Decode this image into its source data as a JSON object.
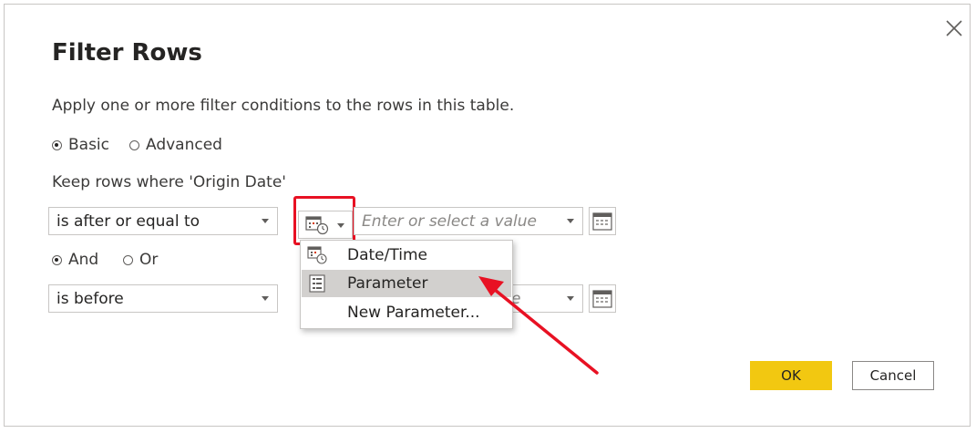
{
  "dialog": {
    "title": "Filter Rows",
    "description": "Apply one or more filter conditions to the rows in this table."
  },
  "mode": {
    "basic_label": "Basic",
    "advanced_label": "Advanced",
    "selected": "Basic"
  },
  "keep_rows_label": "Keep rows where 'Origin Date'",
  "condition1": {
    "operator": "is after or equal to",
    "value_placeholder": "Enter or select a value"
  },
  "logic": {
    "and_label": "And",
    "or_label": "Or",
    "selected": "And"
  },
  "condition2": {
    "operator": "is before",
    "value_fragment": "e"
  },
  "type_menu": {
    "items": [
      {
        "label": "Date/Time",
        "icon": "datetime-icon"
      },
      {
        "label": "Parameter",
        "icon": "parameter-icon"
      },
      {
        "label": "New Parameter...",
        "icon": ""
      }
    ],
    "highlighted": "Parameter"
  },
  "buttons": {
    "ok_label": "OK",
    "cancel_label": "Cancel"
  },
  "colors": {
    "accent_yellow": "#f2c811",
    "highlight_red": "#e81123",
    "menu_highlight": "#d2d0ce"
  }
}
